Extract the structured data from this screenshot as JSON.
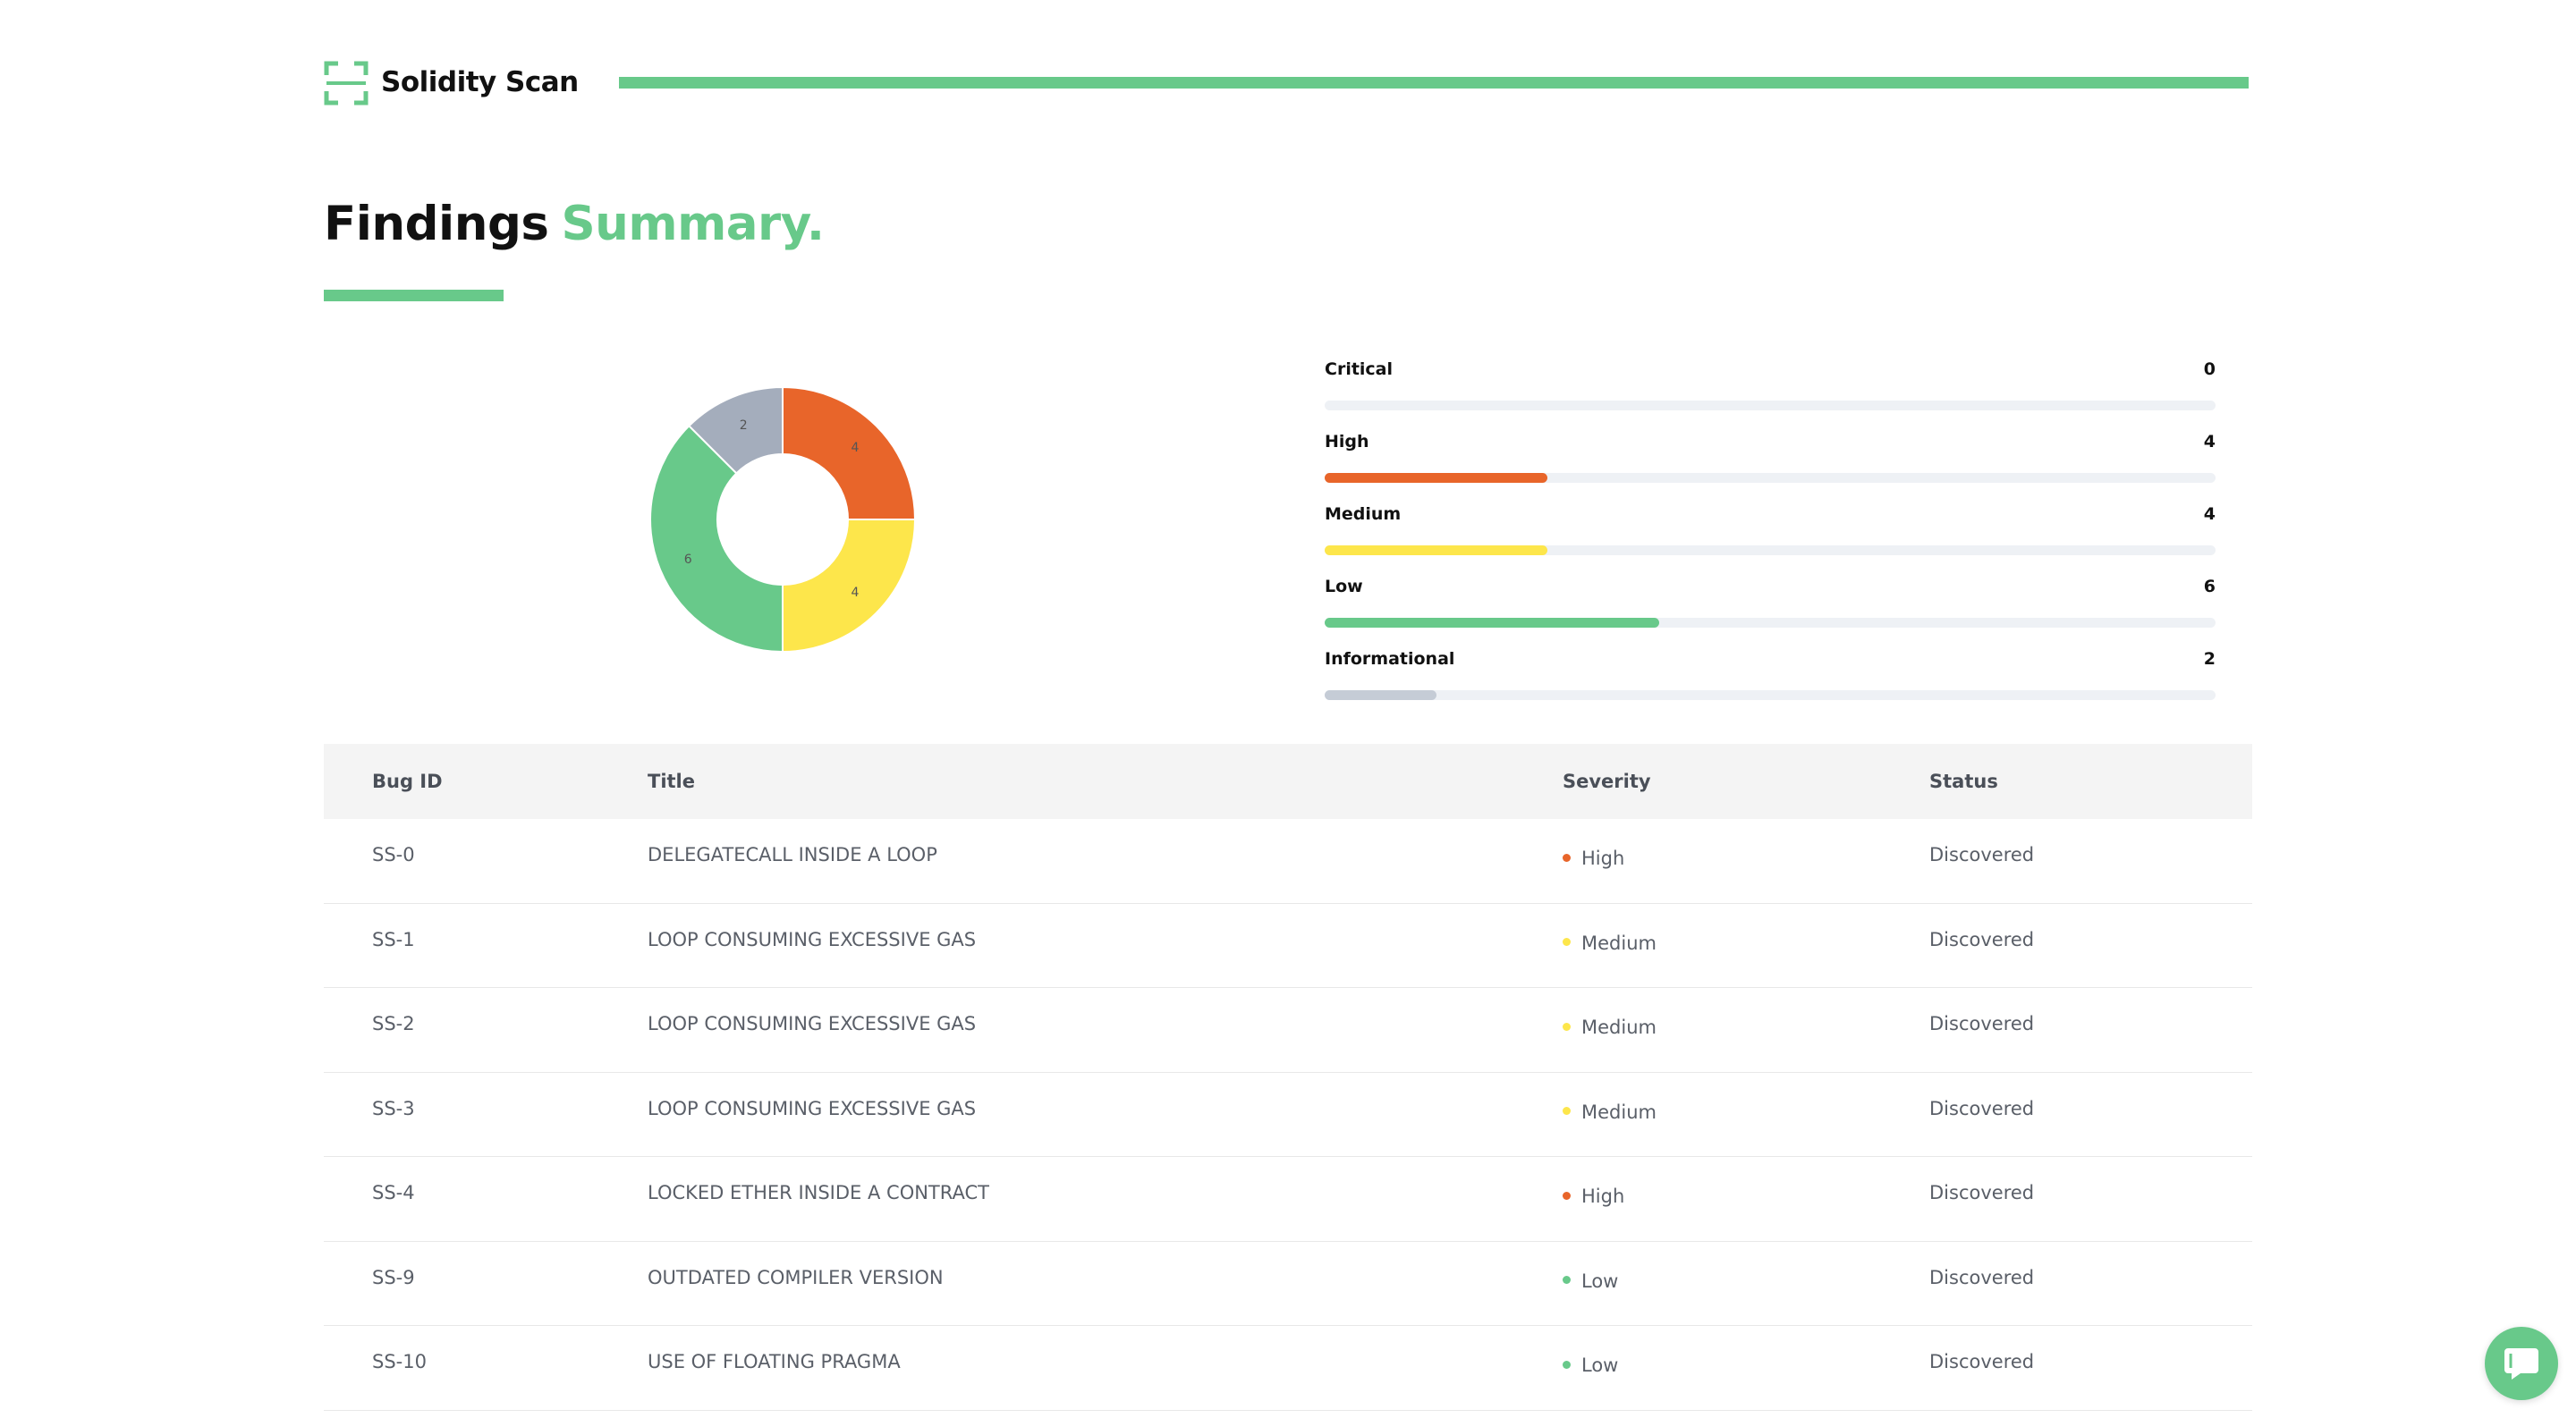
{
  "brand": {
    "name": "Solidity Scan"
  },
  "colors": {
    "accent": "#68c98a",
    "critical": "#d12c2c",
    "high": "#e8652a",
    "medium": "#fde64b",
    "low": "#68c98a",
    "informational": "#a4adbc"
  },
  "summary": {
    "title_part1": "Findings",
    "title_part2": "Summary."
  },
  "chart_data": {
    "type": "pie",
    "donut": true,
    "categories": [
      "High",
      "Medium",
      "Low",
      "Informational"
    ],
    "values": [
      4,
      4,
      6,
      2
    ],
    "slice_labels": [
      "4",
      "4",
      "6",
      "2"
    ],
    "colors": [
      "#e8652a",
      "#fde64b",
      "#68c98a",
      "#a4adbc"
    ]
  },
  "severity_breakdown": {
    "max": 16,
    "items": [
      {
        "label": "Critical",
        "count": "0",
        "value": 0,
        "color": "#d12c2c"
      },
      {
        "label": "High",
        "count": "4",
        "value": 4,
        "color": "#e8652a"
      },
      {
        "label": "Medium",
        "count": "4",
        "value": 4,
        "color": "#fde64b"
      },
      {
        "label": "Low",
        "count": "6",
        "value": 6,
        "color": "#68c98a"
      },
      {
        "label": "Informational",
        "count": "2",
        "value": 2,
        "color": "#c5ccd6"
      }
    ]
  },
  "table": {
    "headers": {
      "bug_id": "Bug ID",
      "title": "Title",
      "severity": "Severity",
      "status": "Status"
    },
    "rows": [
      {
        "bug_id": "SS-0",
        "title": "DELEGATECALL INSIDE A LOOP",
        "severity": "High",
        "severity_color": "#e8652a",
        "status": "Discovered"
      },
      {
        "bug_id": "SS-1",
        "title": "LOOP CONSUMING EXCESSIVE GAS",
        "severity": "Medium",
        "severity_color": "#fde64b",
        "status": "Discovered"
      },
      {
        "bug_id": "SS-2",
        "title": "LOOP CONSUMING EXCESSIVE GAS",
        "severity": "Medium",
        "severity_color": "#fde64b",
        "status": "Discovered"
      },
      {
        "bug_id": "SS-3",
        "title": "LOOP CONSUMING EXCESSIVE GAS",
        "severity": "Medium",
        "severity_color": "#fde64b",
        "status": "Discovered"
      },
      {
        "bug_id": "SS-4",
        "title": "LOCKED ETHER INSIDE A CONTRACT",
        "severity": "High",
        "severity_color": "#e8652a",
        "status": "Discovered"
      },
      {
        "bug_id": "SS-9",
        "title": "OUTDATED COMPILER VERSION",
        "severity": "Low",
        "severity_color": "#68c98a",
        "status": "Discovered"
      },
      {
        "bug_id": "SS-10",
        "title": "USE OF FLOATING PRAGMA",
        "severity": "Low",
        "severity_color": "#68c98a",
        "status": "Discovered"
      }
    ]
  },
  "chat": {
    "icon": "chat-icon"
  }
}
